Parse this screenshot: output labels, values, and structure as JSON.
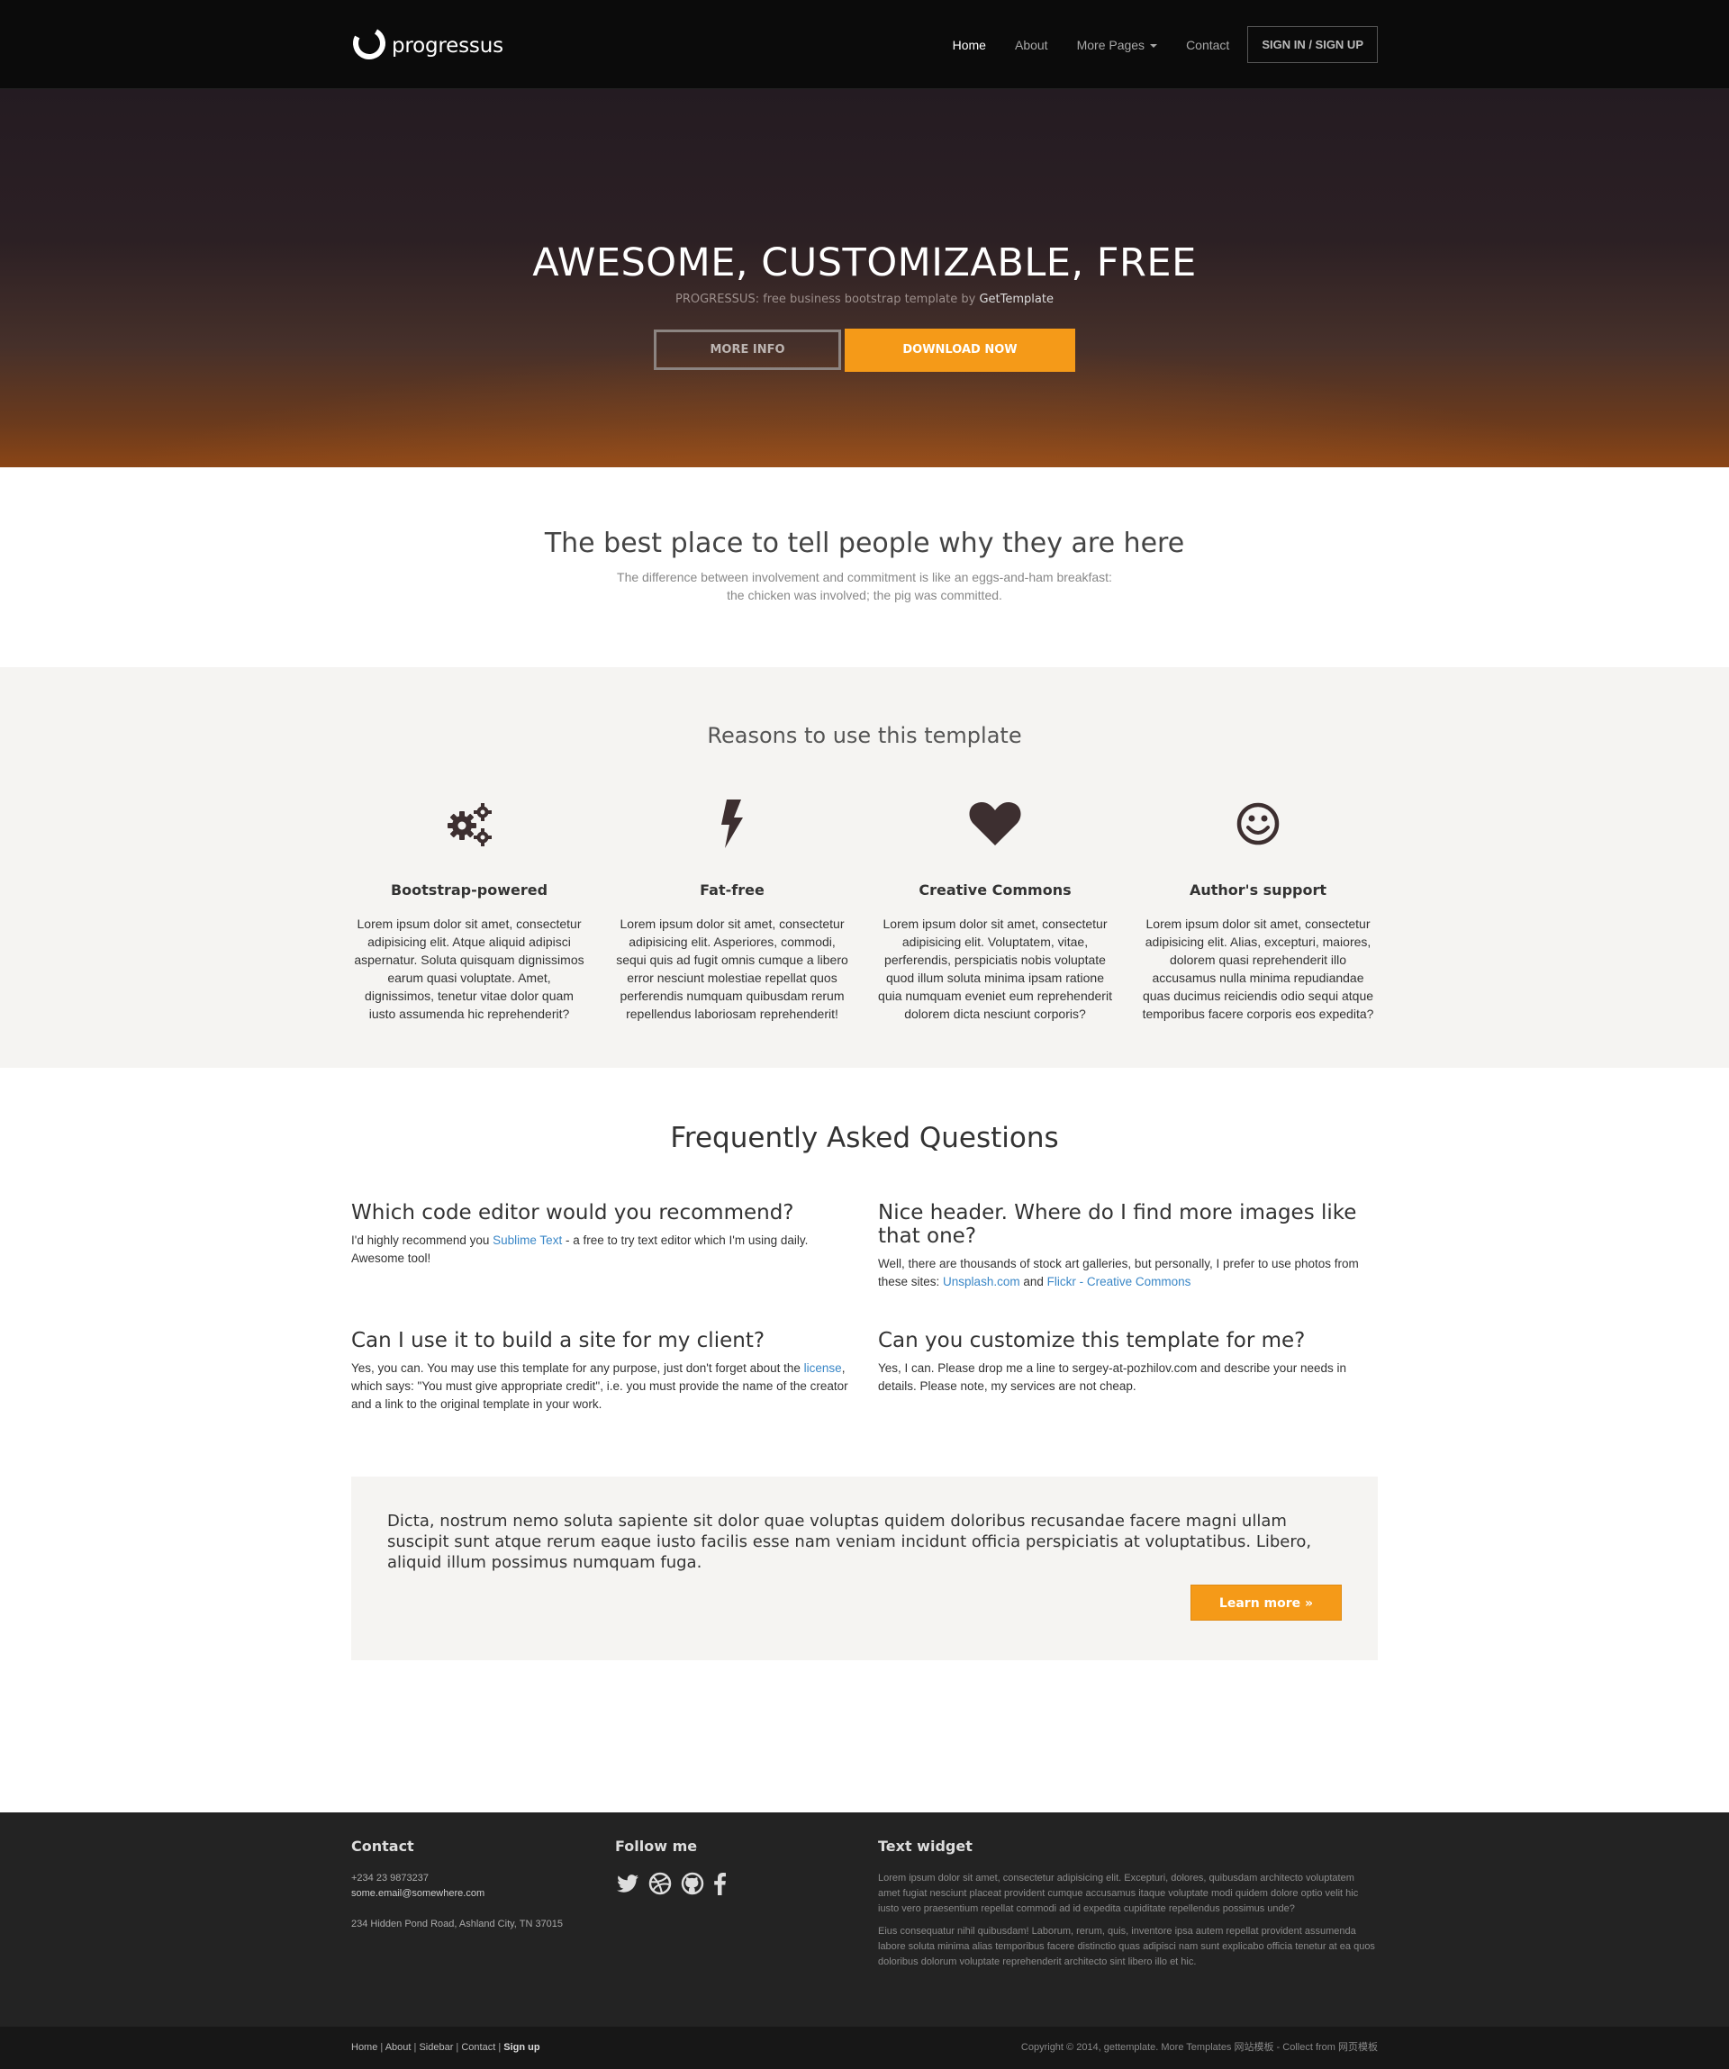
{
  "nav": {
    "brand": "progressus",
    "items": [
      "Home",
      "About",
      "More Pages",
      "Contact"
    ],
    "signin": "SIGN IN / SIGN UP"
  },
  "hero": {
    "title": "AWESOME, CUSTOMIZABLE, FREE",
    "subtitle_prefix": "PROGRESSUS: free business bootstrap template by ",
    "subtitle_link": "GetTemplate",
    "btn_more": "MORE INFO",
    "btn_download": "DOWNLOAD NOW"
  },
  "lead": {
    "title": "The best place to tell people why they are here",
    "line1": "The difference between involvement and commitment is like an eggs-and-ham breakfast:",
    "line2": "the chicken was involved; the pig was committed."
  },
  "features": {
    "title": "Reasons to use this template",
    "items": [
      {
        "icon": "gears-icon",
        "title": "Bootstrap-powered",
        "text": "Lorem ipsum dolor sit amet, consectetur adipisicing elit. Atque aliquid adipisci aspernatur. Soluta quisquam dignissimos earum quasi voluptate. Amet, dignissimos, tenetur vitae dolor quam iusto assumenda hic reprehenderit?"
      },
      {
        "icon": "flash-icon",
        "title": "Fat-free",
        "text": "Lorem ipsum dolor sit amet, consectetur adipisicing elit. Asperiores, commodi, sequi quis ad fugit omnis cumque a libero error nesciunt molestiae repellat quos perferendis numquam quibusdam rerum repellendus laboriosam reprehenderit!"
      },
      {
        "icon": "heart-icon",
        "title": "Creative Commons",
        "text": "Lorem ipsum dolor sit amet, consectetur adipisicing elit. Voluptatem, vitae, perferendis, perspiciatis nobis voluptate quod illum soluta minima ipsam ratione quia numquam eveniet eum reprehenderit dolorem dicta nesciunt corporis?"
      },
      {
        "icon": "smiley-icon",
        "title": "Author's support",
        "text": "Lorem ipsum dolor sit amet, consectetur adipisicing elit. Alias, excepturi, maiores, dolorem quasi reprehenderit illo accusamus nulla minima repudiandae quas ducimus reiciendis odio sequi atque temporibus facere corporis eos expedita?"
      }
    ]
  },
  "faq": {
    "title": "Frequently Asked Questions",
    "q1": {
      "title": "Which code editor would you recommend?",
      "pre": "I'd highly recommend you ",
      "link": "Sublime Text",
      "post": " - a free to try text editor which I'm using daily. Awesome tool!"
    },
    "q2": {
      "title": "Nice header. Where do I find more images like that one?",
      "pre": "Well, there are thousands of stock art galleries, but personally, I prefer to use photos from these sites: ",
      "link1": "Unsplash.com",
      "mid": " and ",
      "link2": "Flickr - Creative Commons"
    },
    "q3": {
      "title": "Can I use it to build a site for my client?",
      "pre": "Yes, you can. You may use this template for any purpose, just don't forget about the ",
      "link": "license",
      "post": ", which says: \"You must give appropriate credit\", i.e. you must provide the name of the creator and a link to the original template in your work."
    },
    "q4": {
      "title": "Can you customize this template for me?",
      "text": "Yes, I can. Please drop me a line to sergey-at-pozhilov.com and describe your needs in details. Please note, my services are not cheap."
    }
  },
  "jumbo": {
    "text": "Dicta, nostrum nemo soluta sapiente sit dolor quae voluptas quidem doloribus recusandae facere magni ullam suscipit sunt atque rerum eaque iusto facilis esse nam veniam incidunt officia perspiciatis at voluptatibus. Libero, aliquid illum possimus numquam fuga.",
    "button": "Learn more »"
  },
  "footer": {
    "contact_title": "Contact",
    "phone": "+234 23 9873237",
    "email": "some.email@somewhere.com",
    "address": "234 Hidden Pond Road, Ashland City, TN 37015",
    "follow_title": "Follow me",
    "social": [
      "twitter-icon",
      "dribbble-icon",
      "github-icon",
      "facebook-icon"
    ],
    "widget_title": "Text widget",
    "widget_p1": "Lorem ipsum dolor sit amet, consectetur adipisicing elit. Excepturi, dolores, quibusdam architecto voluptatem amet fugiat nesciunt placeat provident cumque accusamus itaque voluptate modi quidem dolore optio velit hic iusto vero praesentium repellat commodi ad id expedita cupiditate repellendus possimus unde?",
    "widget_p2": "Eius consequatur nihil quibusdam! Laborum, rerum, quis, inventore ipsa autem repellat provident assumenda labore soluta minima alias temporibus facere distinctio quas adipisci nam sunt explicabo officia tenetur at ea quos doloribus dolorum voluptate reprehenderit architecto sint libero illo et hic."
  },
  "bottom": {
    "links": [
      "Home",
      "About",
      "Sidebar",
      "Contact",
      "Sign up"
    ],
    "copyright": "Copyright © 2014, gettemplate. More Templates 网站模板 - Collect from 网页模板"
  },
  "colors": {
    "accent": "#f59a18",
    "link": "#3a87c7",
    "dark": "#0b0b0b",
    "footer": "#232323"
  }
}
